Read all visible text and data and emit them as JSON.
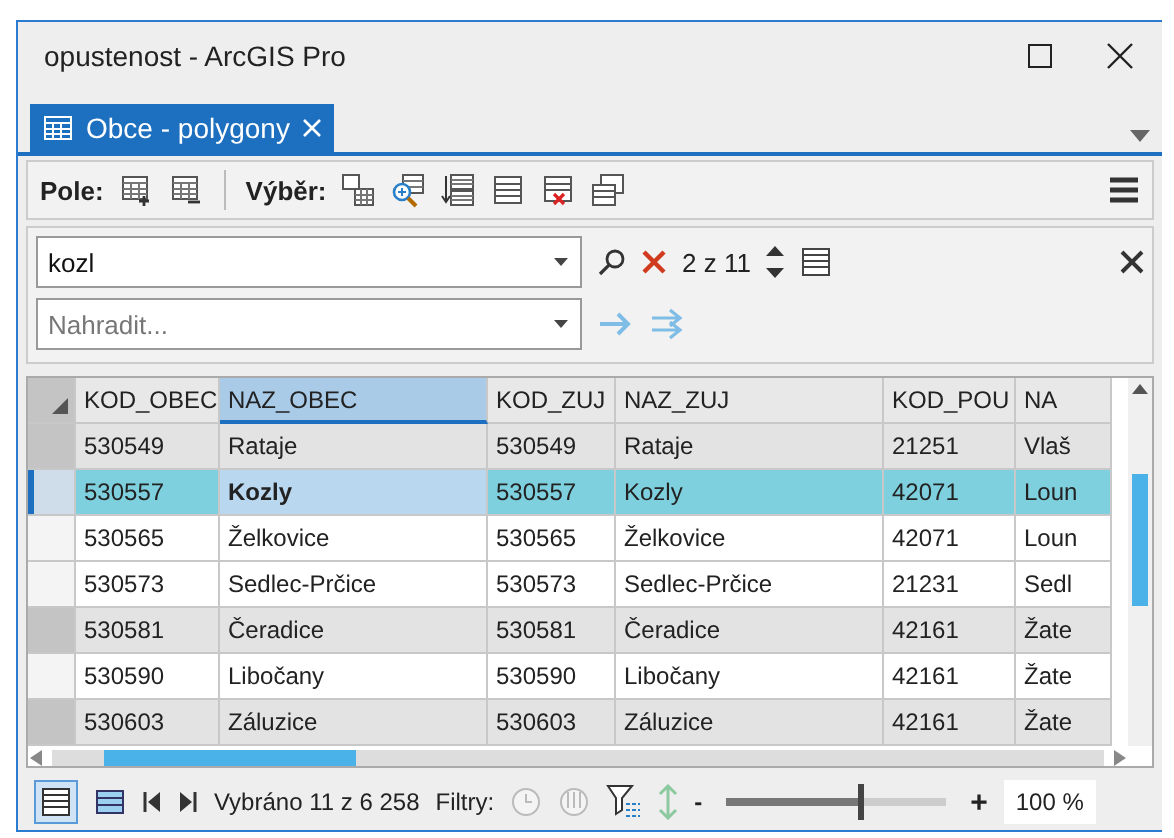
{
  "window": {
    "title": "opustenost - ArcGIS Pro"
  },
  "tabs": [
    {
      "label": "Obce - polygony",
      "selected": true
    }
  ],
  "toolbar": {
    "fields_label": "Pole:",
    "selection_label": "Výběr:"
  },
  "find": {
    "value": "kozl",
    "match_count": "2 z 11"
  },
  "replace": {
    "placeholder": "Nahradit..."
  },
  "table": {
    "columns": [
      {
        "label": "KOD_OBEC",
        "selected": false
      },
      {
        "label": "NAZ_OBEC",
        "selected": true
      },
      {
        "label": "KOD_ZUJ",
        "selected": false
      },
      {
        "label": "NAZ_ZUJ",
        "selected": false
      },
      {
        "label": "KOD_POU",
        "selected": false
      },
      {
        "label": "NA",
        "selected": false
      }
    ],
    "rows": [
      {
        "cells": [
          "530549",
          "Rataje",
          "530549",
          "Rataje",
          "21251",
          "Vlaš"
        ],
        "selected": true,
        "current": false
      },
      {
        "cells": [
          "530557",
          "Kozly",
          "530557",
          "Kozly",
          "42071",
          "Loun"
        ],
        "selected": true,
        "current": true
      },
      {
        "cells": [
          "530565",
          "Želkovice",
          "530565",
          "Želkovice",
          "42071",
          "Loun"
        ],
        "selected": false,
        "current": false
      },
      {
        "cells": [
          "530573",
          "Sedlec-Prčice",
          "530573",
          "Sedlec-Prčice",
          "21231",
          "Sedl"
        ],
        "selected": false,
        "current": false
      },
      {
        "cells": [
          "530581",
          "Čeradice",
          "530581",
          "Čeradice",
          "42161",
          "Žate"
        ],
        "selected": true,
        "current": false
      },
      {
        "cells": [
          "530590",
          "Libočany",
          "530590",
          "Libočany",
          "42161",
          "Žate"
        ],
        "selected": false,
        "current": false
      },
      {
        "cells": [
          "530603",
          "Záluzice",
          "530603",
          "Záluzice",
          "42161",
          "Žate"
        ],
        "selected": true,
        "current": false
      }
    ]
  },
  "status": {
    "selection": "Vybráno 11 z 6 258",
    "filters_label": "Filtry:",
    "zoom_out": "-",
    "zoom_in": "+",
    "zoom": {
      "level": 0.62
    },
    "zoom_reading": "100 %"
  }
}
